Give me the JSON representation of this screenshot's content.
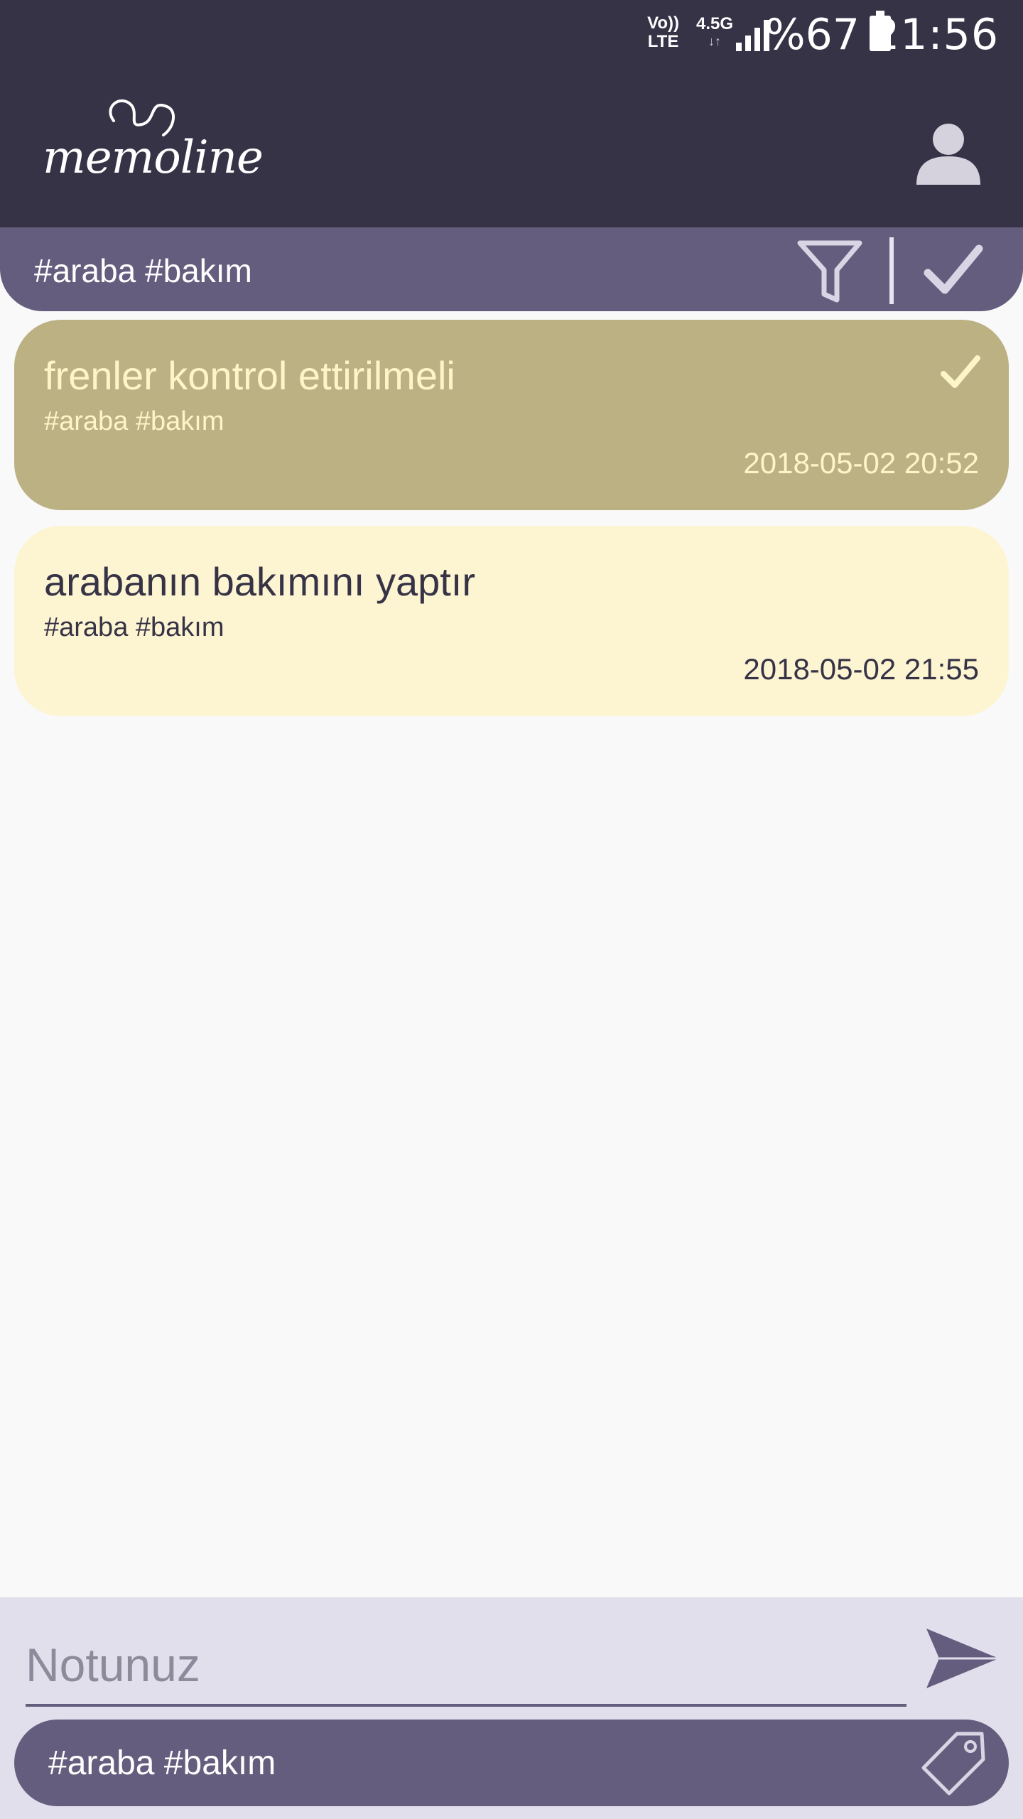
{
  "status_bar": {
    "volte": "Vo))",
    "lte": "LTE",
    "network": "4.5G",
    "network_arrows": "↓↑",
    "battery_percent": "%67",
    "time": "21:56"
  },
  "app_bar": {
    "logo": "memoline",
    "profile_icon": "person-icon"
  },
  "filter_bar": {
    "text": "#araba #bakım",
    "filter_icon": "funnel-icon",
    "done_icon": "check-icon"
  },
  "notes": [
    {
      "title": "frenler kontrol ettirilmeli",
      "tags": "#araba #bakım",
      "date": "2018-05-02 20:52",
      "completed": true
    },
    {
      "title": "arabanın bakımını yaptır",
      "tags": "#araba #bakım",
      "date": "2018-05-02 21:55",
      "completed": false
    }
  ],
  "composer": {
    "placeholder": "Notunuz",
    "value": "",
    "send_icon": "send-icon",
    "tags": "#araba #bakım",
    "tag_icon": "tag-icon"
  },
  "colors": {
    "header": "#363346",
    "accent": "#655d7e",
    "completed_note": "#bcb183",
    "open_note": "#fdf5d2",
    "composer_bg": "#e1dfec"
  }
}
